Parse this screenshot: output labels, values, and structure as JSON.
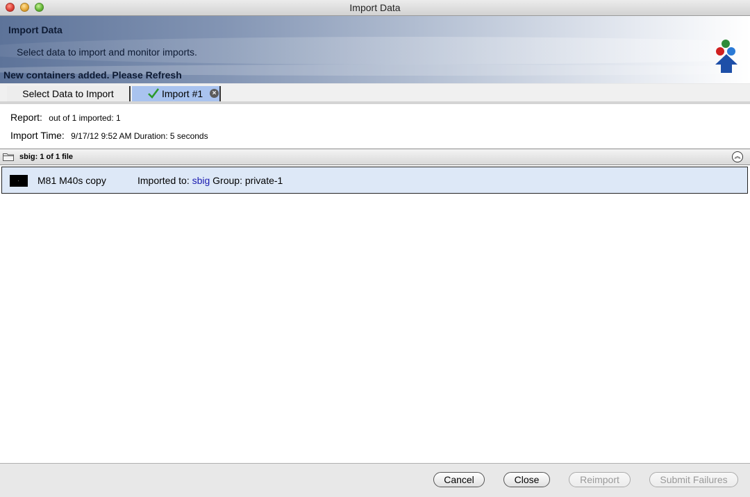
{
  "window": {
    "title": "Import Data"
  },
  "banner": {
    "title": "Import Data",
    "subtitle": "Select data to import and monitor imports.",
    "notice": "New containers added. Please Refresh"
  },
  "tabs": [
    {
      "label": "Select Data to Import",
      "active": false
    },
    {
      "label": "Import #1",
      "active": true,
      "status": "success"
    }
  ],
  "report": {
    "report_label": "Report:",
    "report_value": "out of 1 imported: 1",
    "time_label": "Import Time:",
    "time_value": "9/17/12 9:52 AM Duration:  5 seconds"
  },
  "group": {
    "title": "sbig: 1 of 1 file"
  },
  "files": [
    {
      "name": "M81 M40s copy",
      "imported_prefix": "Imported to:",
      "imported_target": "sbig",
      "group_text": "Group: private-1"
    }
  ],
  "buttons": {
    "cancel": "Cancel",
    "close": "Close",
    "reimport": "Reimport",
    "submit_failures": "Submit Failures"
  },
  "colors": {
    "active_tab": "#a9c3ef",
    "selected_row": "#dde8f7",
    "link": "#1a1ab0"
  }
}
